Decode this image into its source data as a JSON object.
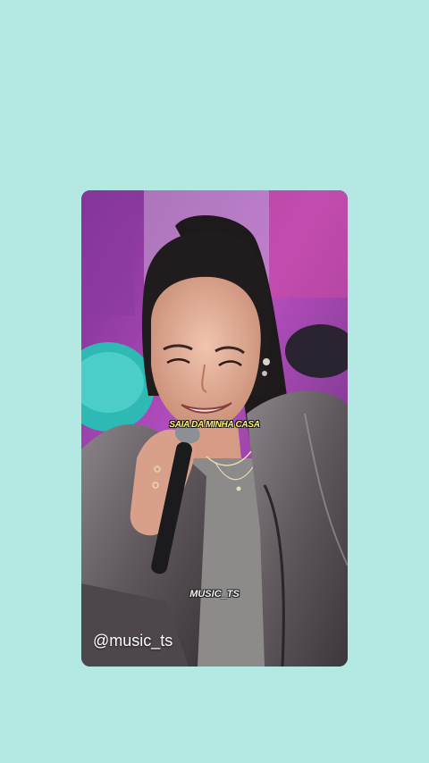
{
  "video": {
    "caption": "SAIA DA MINHA CASA",
    "watermark": "MUSIC_TS",
    "handle": "@music_ts"
  },
  "colors": {
    "page_background": "#b3e9e2",
    "caption_text": "#fff86a"
  }
}
